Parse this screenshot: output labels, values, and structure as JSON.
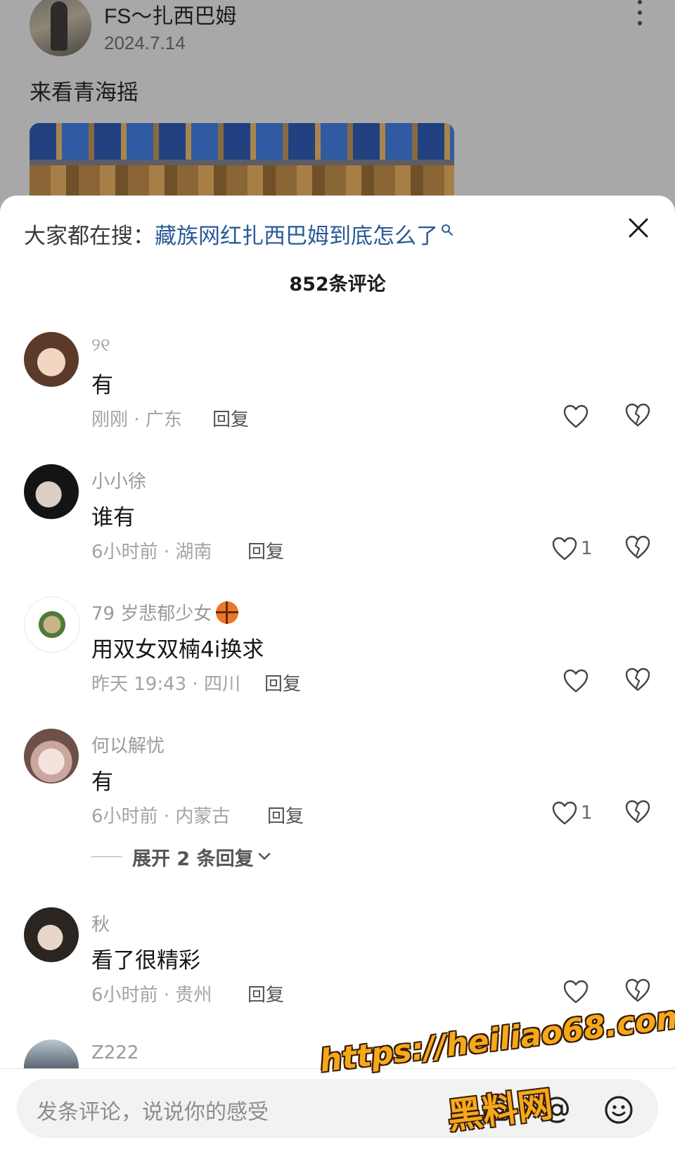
{
  "post": {
    "author": "FS～扎西巴姆",
    "date": "2024.7.14",
    "caption": "来看青海摇"
  },
  "sheet": {
    "search_prefix": "大家都在搜：",
    "search_query": "藏族网红扎西巴姆到底怎么了",
    "comment_count": "852条评论"
  },
  "comments": [
    {
      "user": "୨୧",
      "text": "有",
      "time": "刚刚",
      "location": "广东",
      "reply": "回复",
      "likes": ""
    },
    {
      "user": "小小徐",
      "text": "谁有",
      "time": "6小时前",
      "location": "湖南",
      "reply": "回复",
      "likes": "1"
    },
    {
      "user": "79 岁悲郁少女",
      "text": "用双女双楠4i换求",
      "time": "昨天 19:43",
      "location": "四川",
      "reply": "回复",
      "likes": ""
    },
    {
      "user": "何以解忧",
      "text": "有",
      "time": "6小时前",
      "location": "内蒙古",
      "reply": "回复",
      "likes": "1"
    },
    {
      "user": "秋",
      "text": "看了很精彩",
      "time": "6小时前",
      "location": "贵州",
      "reply": "回复",
      "likes": ""
    },
    {
      "user": "Z222"
    }
  ],
  "expand_replies": "展开 2 条回复",
  "input": {
    "placeholder": "发条评论，说说你的感受"
  },
  "watermark": {
    "url": "https://heiliao68.com",
    "name": "黑料网"
  },
  "colors": {
    "link": "#2a5a95",
    "watermark": "#f6a81b"
  }
}
